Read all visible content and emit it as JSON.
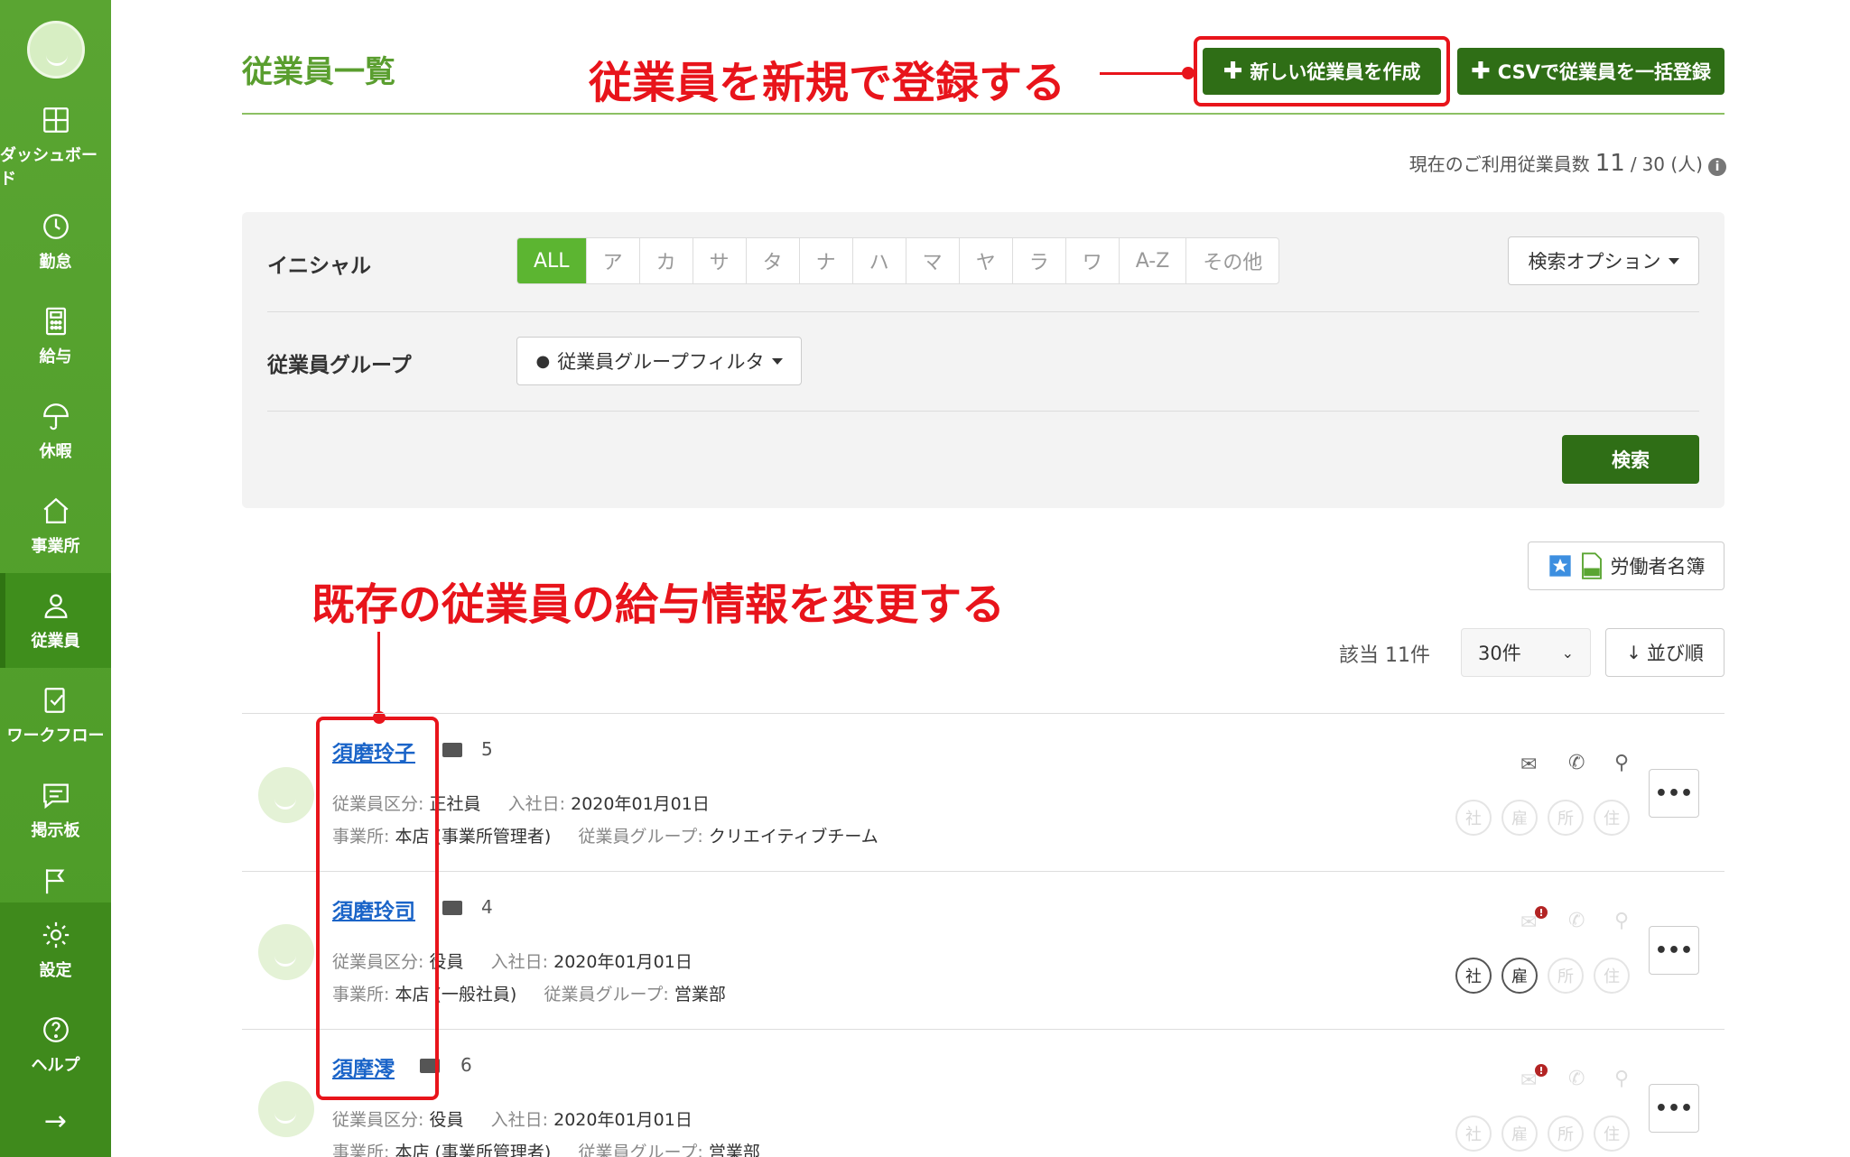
{
  "sidebar": {
    "items": [
      {
        "label": "ダッシュボード",
        "icon": "dashboard-icon"
      },
      {
        "label": "勤怠",
        "icon": "clock-icon"
      },
      {
        "label": "給与",
        "icon": "calculator-icon"
      },
      {
        "label": "休暇",
        "icon": "umbrella-icon"
      },
      {
        "label": "事業所",
        "icon": "home-icon"
      },
      {
        "label": "従業員",
        "icon": "person-icon",
        "active": true
      },
      {
        "label": "ワークフロー",
        "icon": "checklist-icon"
      },
      {
        "label": "掲示板",
        "icon": "chat-icon"
      },
      {
        "label": "",
        "icon": "flag-icon"
      },
      {
        "label": "設定",
        "icon": "gear-icon"
      },
      {
        "label": "ヘルプ",
        "icon": "help-icon"
      }
    ],
    "collapse_icon": "arrow-right-icon"
  },
  "header": {
    "title": "従業員一覧",
    "new_employee_button": "新しい従業員を作成",
    "csv_button": "CSVで従業員を一括登録"
  },
  "annotations": {
    "register_new": "従業員を新規で登録する",
    "change_salary": "既存の従業員の給与情報を変更する"
  },
  "usage": {
    "label": "現在のご利用従業員数",
    "current": "11",
    "separator": "/",
    "limit": "30 (人)"
  },
  "filter": {
    "initial_label": "イニシャル",
    "initials": [
      "ALL",
      "ア",
      "カ",
      "サ",
      "タ",
      "ナ",
      "ハ",
      "マ",
      "ヤ",
      "ラ",
      "ワ",
      "A-Z",
      "その他"
    ],
    "search_options": "検索オプション",
    "group_label": "従業員グループ",
    "group_filter": "従業員グループフィルタ",
    "search_button": "検索"
  },
  "results": {
    "roster_button": "労働者名簿",
    "count_text": "該当 11件",
    "per_page": "30件",
    "sort_button": "並び順"
  },
  "employees": [
    {
      "name": "須磨玲子",
      "number": "5",
      "type_label": "従業員区分:",
      "type": "正社員",
      "joined_label": "入社日:",
      "joined": "2020年01月01日",
      "office_label": "事業所:",
      "office": "本店 (事業所管理者)",
      "group_label": "従業員グループ:",
      "group": "クリエイティブチーム"
    },
    {
      "name": "須磨玲司",
      "number": "4",
      "type_label": "従業員区分:",
      "type": "役員",
      "joined_label": "入社日:",
      "joined": "2020年01月01日",
      "office_label": "事業所:",
      "office": "本店 (一般社員)",
      "group_label": "従業員グループ:",
      "group": "営業部"
    },
    {
      "name": "須摩澪",
      "number": "6",
      "type_label": "従業員区分:",
      "type": "役員",
      "joined_label": "入社日:",
      "joined": "2020年01月01日",
      "office_label": "事業所:",
      "office": "本店 (事業所管理者)",
      "group_label": "従業員グループ:",
      "group": "営業部"
    }
  ],
  "insurance_badges": [
    "社",
    "雇",
    "所",
    "住"
  ],
  "colors": {
    "sidebar": "#4b9a26",
    "primary_button": "#2f6e16",
    "annotation": "#e8141b",
    "link": "#1a64c8"
  }
}
